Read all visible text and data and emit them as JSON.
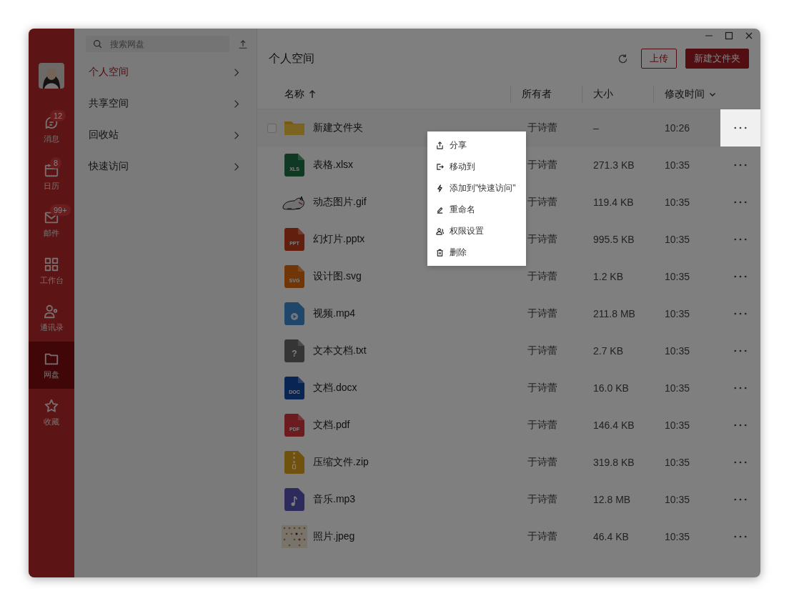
{
  "nav": [
    {
      "label": "消息",
      "badge": "12",
      "selected": false
    },
    {
      "label": "日历",
      "badge": "8",
      "selected": false
    },
    {
      "label": "邮件",
      "badge": "99+",
      "selected": false
    },
    {
      "label": "工作台",
      "selected": false
    },
    {
      "label": "通讯录",
      "selected": false
    },
    {
      "label": "网盘",
      "selected": true
    },
    {
      "label": "收藏",
      "selected": false
    }
  ],
  "search": {
    "placeholder": "搜索网盘"
  },
  "spaces": [
    {
      "label": "个人空间",
      "selected": true
    },
    {
      "label": "共享空间",
      "selected": false
    },
    {
      "label": "回收站",
      "selected": false
    },
    {
      "label": "快速访问",
      "selected": false
    }
  ],
  "title": "个人空间",
  "buttons": {
    "upload": "上传",
    "new_folder": "新建文件夹"
  },
  "columns": [
    {
      "label": "名称",
      "sort_ascending": true
    },
    {
      "label": "所有者"
    },
    {
      "label": "大小"
    },
    {
      "label": "修改时间",
      "sort_ascending": false
    }
  ],
  "rows": [
    {
      "kind": "folder",
      "name": "新建文件夹",
      "owner": "于诗蕾",
      "size": "–",
      "time": "10:26",
      "hovered": true,
      "checked": false
    },
    {
      "kind": "sheet",
      "icon_label": "XLS",
      "name": "表格.xlsx",
      "owner": "于诗蕾",
      "size": "271.3 KB",
      "time": "10:35",
      "hovered": false
    },
    {
      "kind": "gif",
      "name": "动态图片.gif",
      "owner": "于诗蕾",
      "size": "119.4 KB",
      "time": "10:35",
      "hovered": false
    },
    {
      "kind": "slides",
      "icon_label": "PPT",
      "name": "幻灯片.pptx",
      "owner": "于诗蕾",
      "size": "995.5 KB",
      "time": "10:35",
      "hovered": false
    },
    {
      "kind": "vector",
      "icon_label": "SVG",
      "name": "设计图.svg",
      "owner": "于诗蕾",
      "size": "1.2 KB",
      "time": "10:35",
      "hovered": false
    },
    {
      "kind": "video",
      "name": "视频.mp4",
      "owner": "于诗蕾",
      "size": "211.8 MB",
      "time": "10:35",
      "hovered": false
    },
    {
      "kind": "text",
      "icon_label": "?",
      "name": "文本文档.txt",
      "owner": "于诗蕾",
      "size": "2.7 KB",
      "time": "10:35",
      "hovered": false
    },
    {
      "kind": "word",
      "icon_label": "DOC",
      "name": "文档.docx",
      "owner": "于诗蕾",
      "size": "16.0 KB",
      "time": "10:35",
      "hovered": false
    },
    {
      "kind": "pdf",
      "icon_label": "PDF",
      "name": "文档.pdf",
      "owner": "于诗蕾",
      "size": "146.4 KB",
      "time": "10:35",
      "hovered": false
    },
    {
      "kind": "zip",
      "name": "压缩文件.zip",
      "owner": "于诗蕾",
      "size": "319.8 KB",
      "time": "10:35",
      "hovered": false
    },
    {
      "kind": "music",
      "name": "音乐.mp3",
      "owner": "于诗蕾",
      "size": "12.8 MB",
      "time": "10:35",
      "hovered": false
    },
    {
      "name": "照片.jpeg",
      "owner": "于诗蕾",
      "size": "46.4 KB",
      "time": "10:35",
      "hovered": false
    }
  ],
  "menu": [
    "分享",
    "移动到",
    "添加到\"快速访问\"",
    "重命名",
    "权限设置",
    "删除"
  ]
}
